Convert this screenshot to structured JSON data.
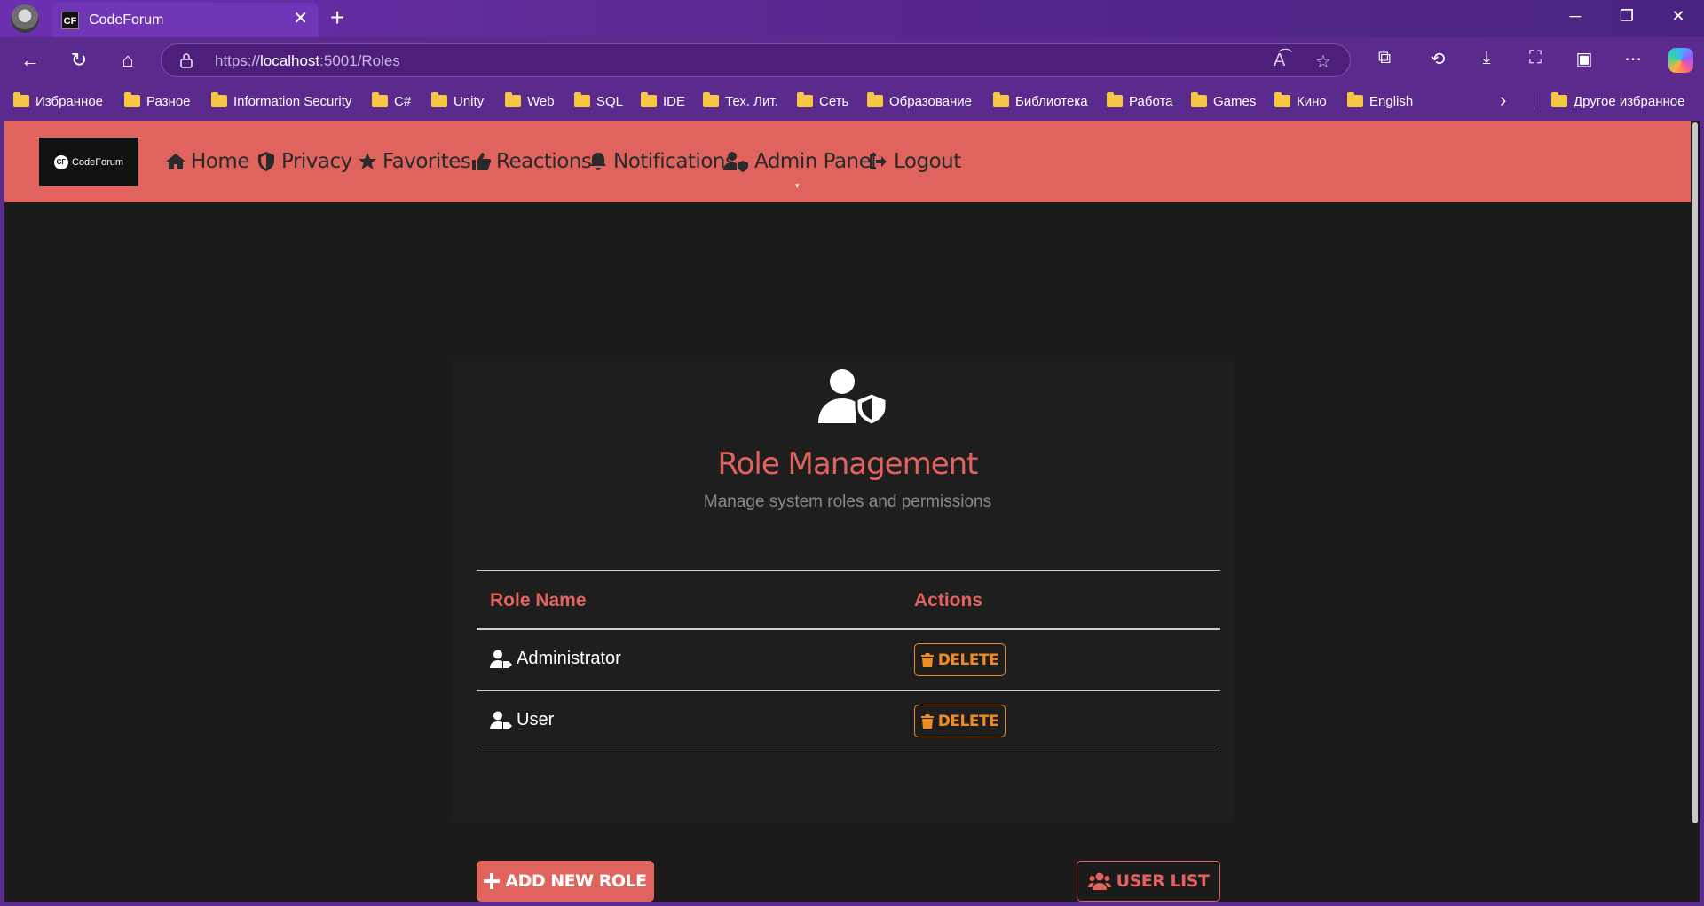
{
  "browser": {
    "tab_title": "CodeForum",
    "tab_favicon": "CF",
    "url_scheme": "https://",
    "url_host": "localhost",
    "url_path": ":5001/Roles",
    "bookmarks": [
      "Избранное",
      "Разное",
      "Information Security",
      "C#",
      "Unity",
      "Web",
      "SQL",
      "IDE",
      "Тех. Лит.",
      "Сеть",
      "Образование",
      "Библиотека",
      "Работа",
      "Games",
      "Кино",
      "English"
    ],
    "other_bookmarks": "Другое избранное"
  },
  "site": {
    "logo_badge": "CF",
    "logo_text": "CodeForum",
    "nav": {
      "home": "Home",
      "privacy": "Privacy",
      "favorites": "Favorites",
      "reactions": "Reactions",
      "notifications": "Notifications",
      "admin": "Admin Panel",
      "logout": "Logout"
    },
    "accent_color": "#e0635e"
  },
  "page": {
    "title": "Role Management",
    "subtitle": "Manage system roles and permissions",
    "table": {
      "headers": {
        "name": "Role Name",
        "actions": "Actions"
      },
      "rows": [
        {
          "name": "Administrator",
          "action": "DELETE"
        },
        {
          "name": "User",
          "action": "DELETE"
        }
      ]
    },
    "add_button": "ADD NEW ROLE",
    "users_button": "USER LIST"
  }
}
